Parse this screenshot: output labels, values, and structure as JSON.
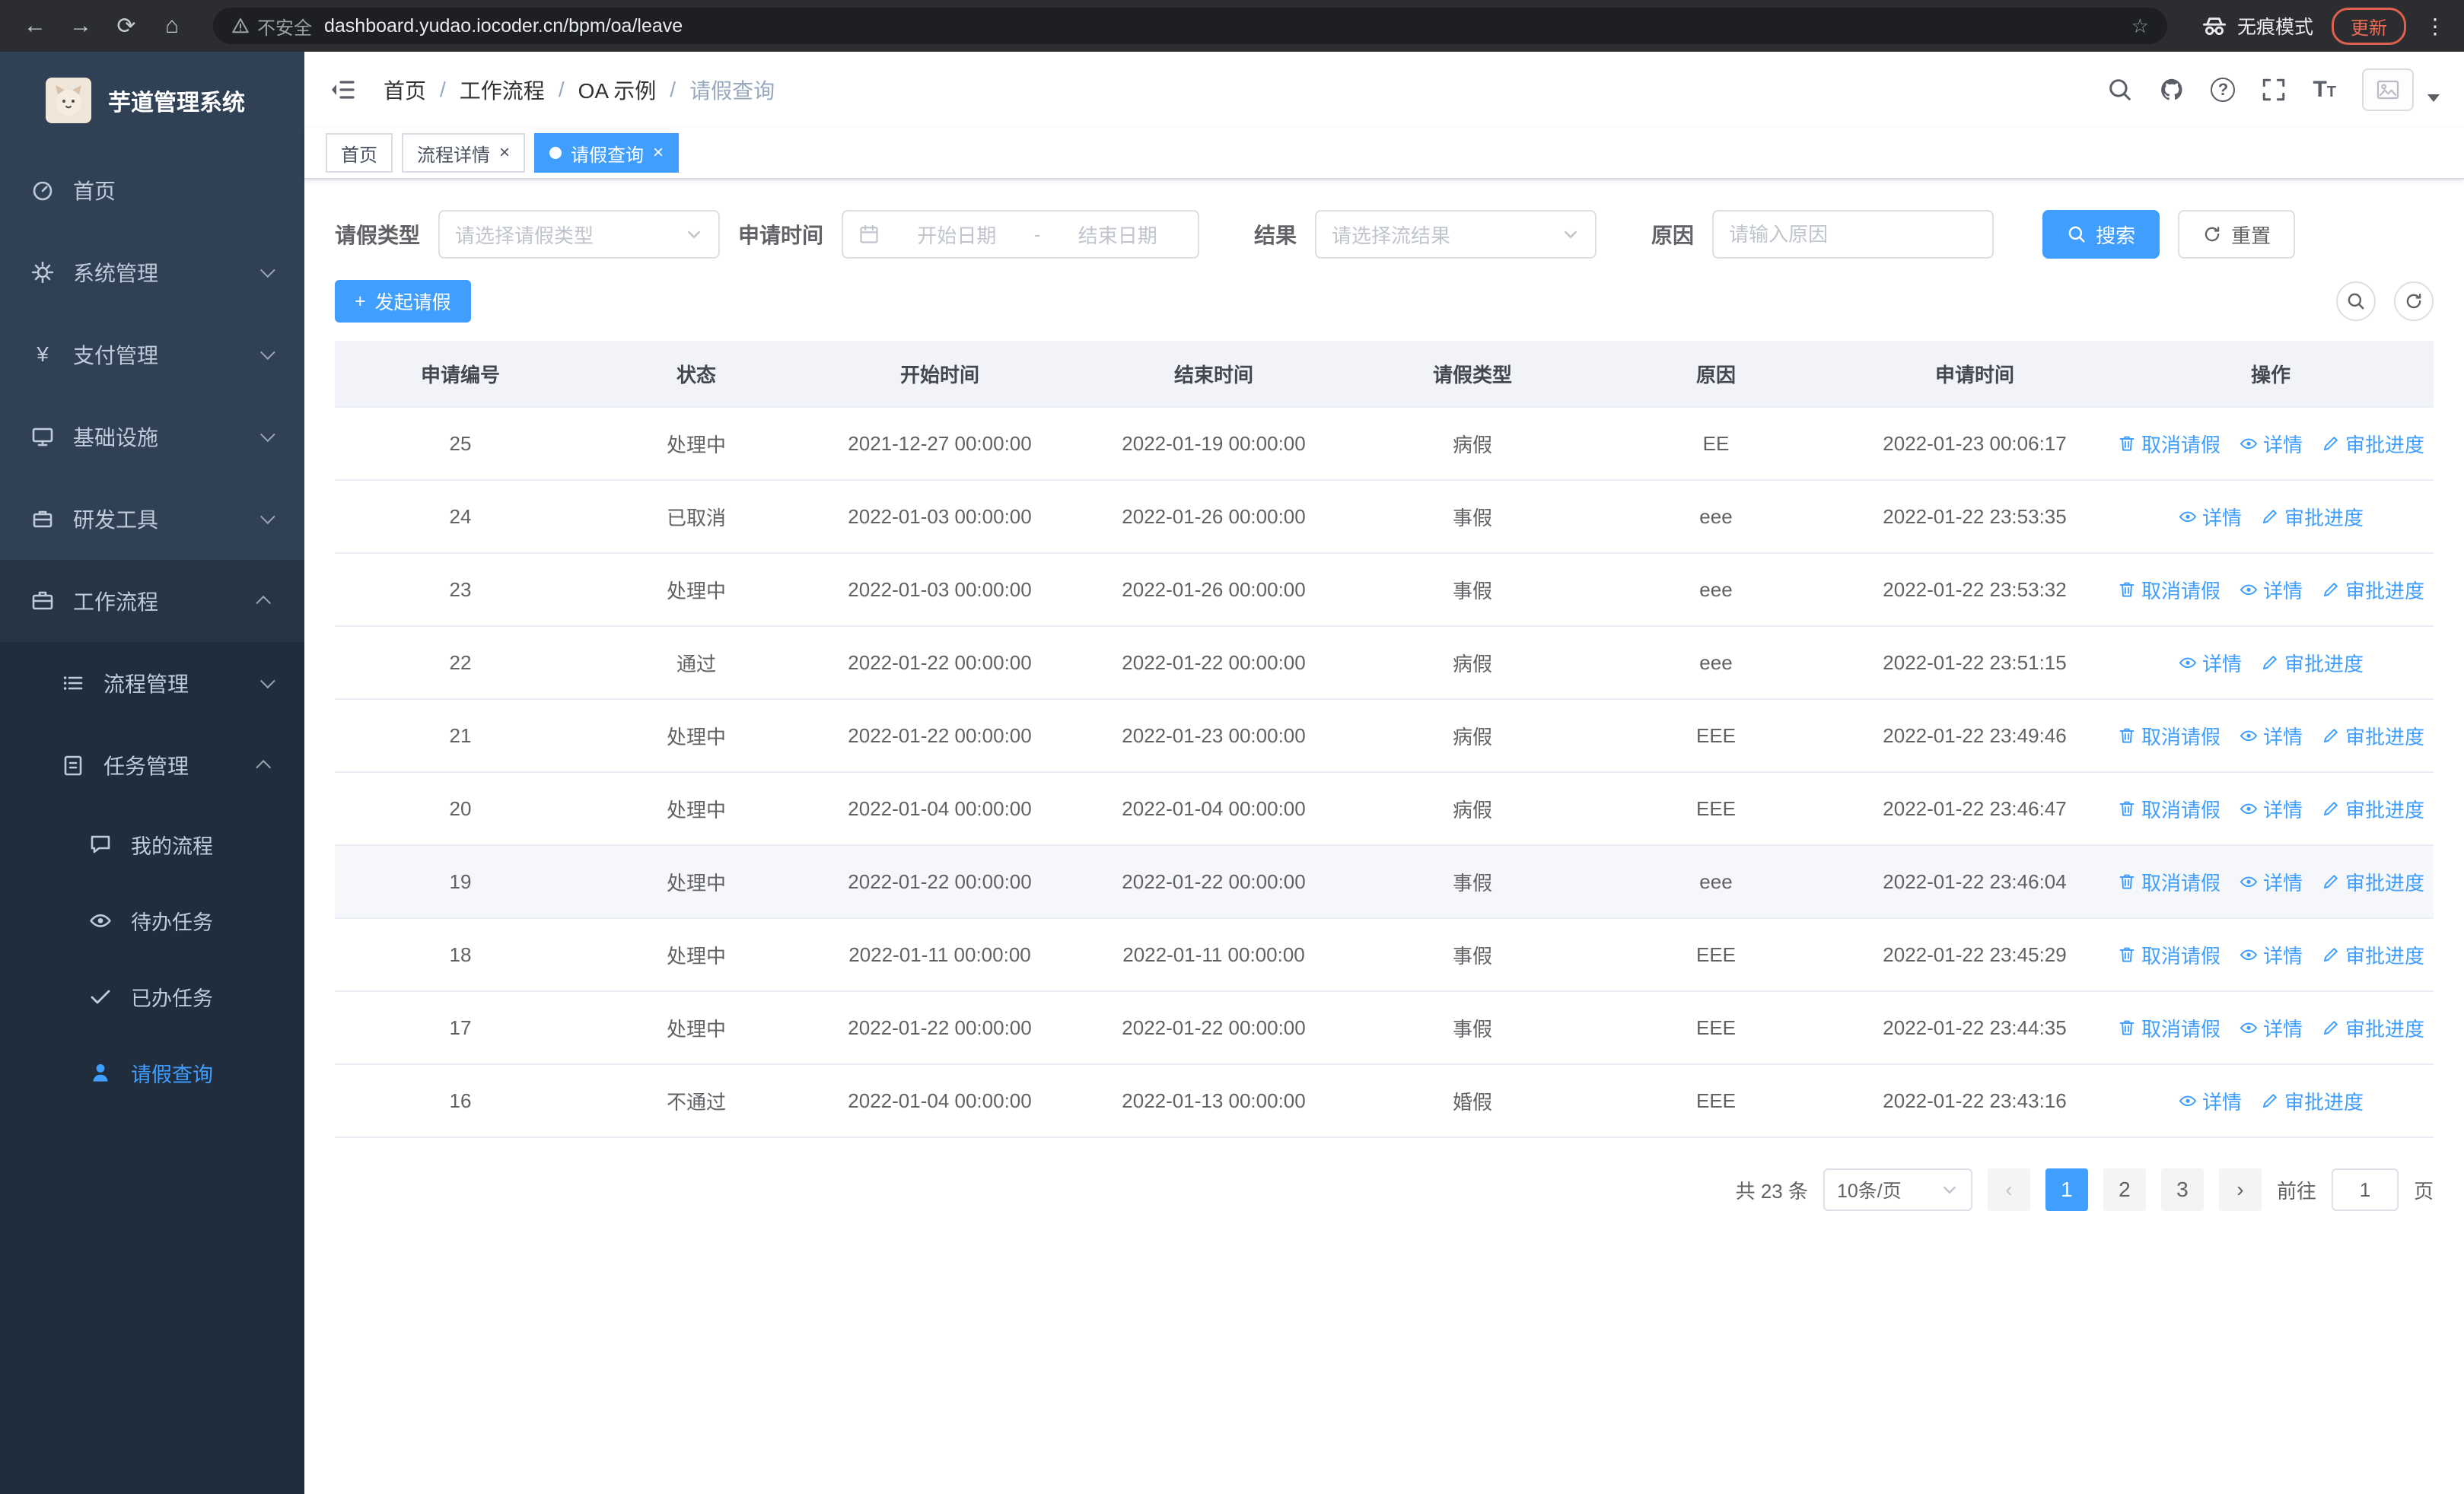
{
  "colors": {
    "primary": "#409eff",
    "sidebar_bg": "#304156",
    "sidebar_sub_bg": "#1f2d3d"
  },
  "browser": {
    "security_label": "不安全",
    "url": "dashboard.yudao.iocoder.cn/bpm/oa/leave",
    "incognito_label": "无痕模式",
    "update_label": "更新",
    "icons": {
      "back": "←",
      "forward": "→",
      "reload": "⟳",
      "home": "⌂",
      "star": "☆",
      "menu": "⋮"
    }
  },
  "sidebar": {
    "app_title": "芋道管理系统",
    "yen_glyph": "¥",
    "items": [
      {
        "label": "首页"
      },
      {
        "label": "系统管理"
      },
      {
        "label": "支付管理"
      },
      {
        "label": "基础设施"
      },
      {
        "label": "研发工具"
      },
      {
        "label": "工作流程"
      },
      {
        "label": "流程管理"
      },
      {
        "label": "任务管理"
      },
      {
        "label": "我的流程"
      },
      {
        "label": "待办任务"
      },
      {
        "label": "已办任务"
      },
      {
        "label": "请假查询"
      }
    ]
  },
  "header": {
    "breadcrumb": [
      "首页",
      "工作流程",
      "OA 示例",
      "请假查询"
    ],
    "breadcrumb_sep": "/",
    "help_glyph": "?",
    "font_icon_glyph": "T"
  },
  "tabs": [
    {
      "label": "首页"
    },
    {
      "label": "流程详情"
    },
    {
      "label": "请假查询"
    }
  ],
  "tab_close_glyph": "×",
  "filters": {
    "leave_type_label": "请假类型",
    "leave_type_placeholder": "请选择请假类型",
    "apply_time_label": "申请时间",
    "start_date_placeholder": "开始日期",
    "range_separator": "-",
    "end_date_placeholder": "结束日期",
    "result_label": "结果",
    "result_placeholder": "请选择流结果",
    "reason_label": "原因",
    "reason_placeholder": "请输入原因",
    "search_button": "搜索",
    "reset_button": "重置"
  },
  "toolbar": {
    "plus_glyph": "+",
    "create_button": "发起请假"
  },
  "table": {
    "columns": [
      "申请编号",
      "状态",
      "开始时间",
      "结束时间",
      "请假类型",
      "原因",
      "申请时间",
      "操作"
    ],
    "rows": [
      {
        "id": "25",
        "status": "处理中",
        "start": "2021-12-27 00:00:00",
        "end": "2022-01-19 00:00:00",
        "type": "病假",
        "reason": "EE",
        "apply": "2022-01-23 00:06:17",
        "cancel": "取消请假",
        "detail": "详情",
        "progress": "审批进度"
      },
      {
        "id": "24",
        "status": "已取消",
        "start": "2022-01-03 00:00:00",
        "end": "2022-01-26 00:00:00",
        "type": "事假",
        "reason": "eee",
        "apply": "2022-01-22 23:53:35",
        "detail": "详情",
        "progress": "审批进度"
      },
      {
        "id": "23",
        "status": "处理中",
        "start": "2022-01-03 00:00:00",
        "end": "2022-01-26 00:00:00",
        "type": "事假",
        "reason": "eee",
        "apply": "2022-01-22 23:53:32",
        "cancel": "取消请假",
        "detail": "详情",
        "progress": "审批进度"
      },
      {
        "id": "22",
        "status": "通过",
        "start": "2022-01-22 00:00:00",
        "end": "2022-01-22 00:00:00",
        "type": "病假",
        "reason": "eee",
        "apply": "2022-01-22 23:51:15",
        "detail": "详情",
        "progress": "审批进度"
      },
      {
        "id": "21",
        "status": "处理中",
        "start": "2022-01-22 00:00:00",
        "end": "2022-01-23 00:00:00",
        "type": "病假",
        "reason": "EEE",
        "apply": "2022-01-22 23:49:46",
        "cancel": "取消请假",
        "detail": "详情",
        "progress": "审批进度"
      },
      {
        "id": "20",
        "status": "处理中",
        "start": "2022-01-04 00:00:00",
        "end": "2022-01-04 00:00:00",
        "type": "病假",
        "reason": "EEE",
        "apply": "2022-01-22 23:46:47",
        "cancel": "取消请假",
        "detail": "详情",
        "progress": "审批进度"
      },
      {
        "id": "19",
        "status": "处理中",
        "start": "2022-01-22 00:00:00",
        "end": "2022-01-22 00:00:00",
        "type": "事假",
        "reason": "eee",
        "apply": "2022-01-22 23:46:04",
        "cancel": "取消请假",
        "detail": "详情",
        "progress": "审批进度",
        "_class": "highlight"
      },
      {
        "id": "18",
        "status": "处理中",
        "start": "2022-01-11 00:00:00",
        "end": "2022-01-11 00:00:00",
        "type": "事假",
        "reason": "EEE",
        "apply": "2022-01-22 23:45:29",
        "cancel": "取消请假",
        "detail": "详情",
        "progress": "审批进度"
      },
      {
        "id": "17",
        "status": "处理中",
        "start": "2022-01-22 00:00:00",
        "end": "2022-01-22 00:00:00",
        "type": "事假",
        "reason": "EEE",
        "apply": "2022-01-22 23:44:35",
        "cancel": "取消请假",
        "detail": "详情",
        "progress": "审批进度"
      },
      {
        "id": "16",
        "status": "不通过",
        "start": "2022-01-04 00:00:00",
        "end": "2022-01-13 00:00:00",
        "type": "婚假",
        "reason": "EEE",
        "apply": "2022-01-22 23:43:16",
        "detail": "详情",
        "progress": "审批进度"
      }
    ]
  },
  "pagination": {
    "total_label": "共 23 条",
    "page_size_label": "10条/页",
    "prev_glyph": "‹",
    "next_glyph": "›",
    "pages": [
      {
        "label": "1",
        "_class": "active"
      },
      {
        "label": "2"
      },
      {
        "label": "3"
      }
    ],
    "goto_prefix": "前往",
    "goto_value": "1",
    "goto_suffix": "页"
  }
}
